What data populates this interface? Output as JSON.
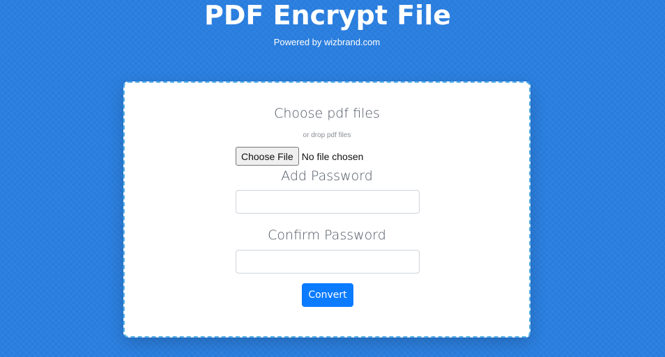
{
  "header": {
    "title": "PDF Encrypt File",
    "subtitle": "Powered by wizbrand.com"
  },
  "upload": {
    "heading": "Choose pdf files",
    "drop_hint": "or drop pdf files",
    "button_label": "Choose File",
    "status": "No file chosen"
  },
  "password": {
    "label": "Add Password",
    "value": ""
  },
  "confirm_password": {
    "label": "Confirm Password",
    "value": ""
  },
  "actions": {
    "convert_label": "Convert"
  },
  "colors": {
    "background": "#2a7fe0",
    "card_border": "#5ab4e8",
    "button_primary": "#0b7bff"
  }
}
